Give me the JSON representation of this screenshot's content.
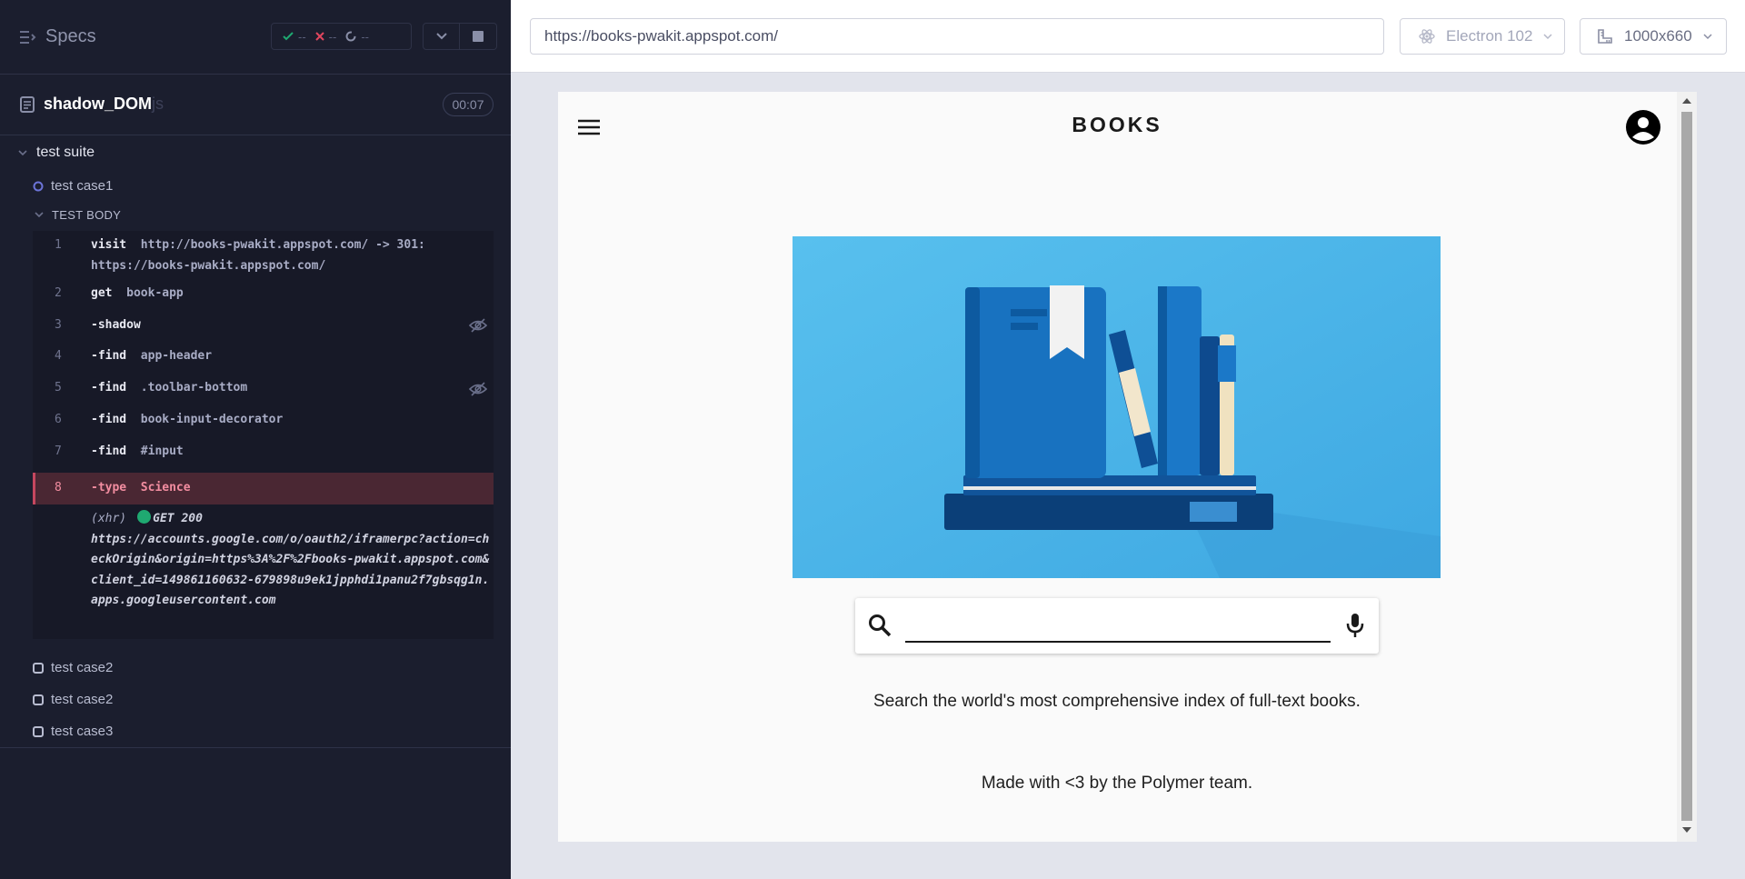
{
  "sidebar": {
    "specs_label": "Specs",
    "stats": {
      "passed": "--",
      "failed": "--",
      "pending": "--"
    },
    "file": {
      "name": "shadow_DOM",
      "ext": "js",
      "duration": "00:07"
    },
    "suite": "test suite",
    "case1": "test case1",
    "test_body_label": "TEST BODY",
    "commands": [
      {
        "num": "1",
        "name": "visit",
        "msg": "http://books-pwakit.appspot.com/ -> 301:",
        "msg2": "https://books-pwakit.appspot.com/"
      },
      {
        "num": "2",
        "name": "get",
        "msg": "book-app"
      },
      {
        "num": "3",
        "name": "-shadow",
        "msg": ""
      },
      {
        "num": "4",
        "name": "-find",
        "msg": "app-header"
      },
      {
        "num": "5",
        "name": "-find",
        "msg": ".toolbar-bottom"
      },
      {
        "num": "6",
        "name": "-find",
        "msg": "book-input-decorator"
      },
      {
        "num": "7",
        "name": "-find",
        "msg": "#input"
      },
      {
        "num": "8",
        "name": "-type",
        "msg": "Science"
      }
    ],
    "xhr": {
      "label": "(xhr)",
      "status": "GET 200",
      "url": "https://accounts.google.com/o/oauth2/iframerpc?action=checkOrigin&origin=https%3A%2F%2Fbooks-pwakit.appspot.com&client_id=149861160632-679898u9ek1jpphdi1panu2f7gbsqg1n.apps.googleusercontent.com"
    },
    "other_cases": [
      "test case2",
      "test case2",
      "test case3"
    ]
  },
  "toolbar": {
    "url": "https://books-pwakit.appspot.com/",
    "browser": "Electron 102",
    "viewport": "1000x660"
  },
  "app": {
    "title": "BOOKS",
    "tagline": "Search the world's most comprehensive index of full-text books.",
    "footer": "Made with <3 by the Polymer team."
  },
  "colors": {
    "sidebar_bg": "#1b1e2e",
    "active_command": "#4a2733",
    "pass": "#1fa971",
    "fail": "#e0465e",
    "hero_sky": "#4cb4e8"
  }
}
